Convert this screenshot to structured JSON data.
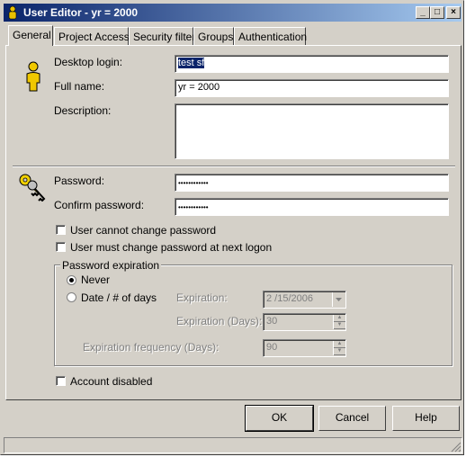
{
  "window": {
    "title": "User Editor - yr = 2000",
    "minimize": "_",
    "maximize": "□",
    "close": "×"
  },
  "tabs": [
    {
      "label": "General"
    },
    {
      "label": "Project Access"
    },
    {
      "label": "Security filter"
    },
    {
      "label": "Groups"
    },
    {
      "label": "Authentication"
    }
  ],
  "general": {
    "desktop_login_label": "Desktop login:",
    "desktop_login_value": "test sf",
    "full_name_label": "Full name:",
    "full_name_value": "yr = 2000",
    "description_label": "Description:",
    "description_value": "",
    "password_label": "Password:",
    "password_value": "••••••••••••",
    "confirm_password_label": "Confirm password:",
    "confirm_password_value": "••••••••••••",
    "cannot_change_label": "User cannot change password",
    "must_change_label": "User must change password at next logon",
    "expiration_group_label": "Password expiration",
    "never_label": "Never",
    "date_days_label": "Date / # of days",
    "expiration_label": "Expiration:",
    "expiration_value": "2 /15/2006",
    "expiration_days_label": "Expiration (Days):",
    "expiration_days_value": "30",
    "frequency_label": "Expiration frequency (Days):",
    "frequency_value": "90",
    "account_disabled_label": "Account disabled"
  },
  "buttons": {
    "ok": "OK",
    "cancel": "Cancel",
    "help": "Help"
  }
}
